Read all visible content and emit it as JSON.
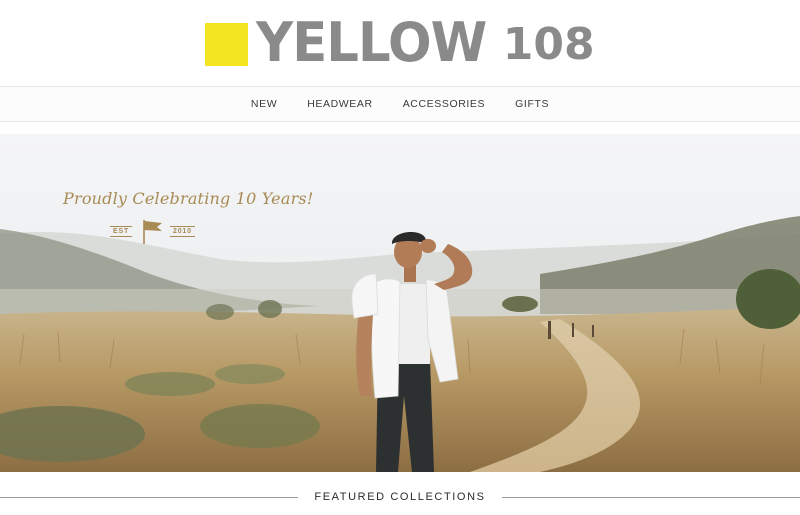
{
  "brand": {
    "wordmark": "YELLOW",
    "number": "108",
    "accent_color": "#f3e621",
    "text_color": "#8a8a8a"
  },
  "nav": {
    "items": [
      {
        "label": "NEW"
      },
      {
        "label": "HEADWEAR"
      },
      {
        "label": "ACCESSORIES"
      },
      {
        "label": "GIFTS"
      }
    ]
  },
  "hero": {
    "tagline": "Proudly Celebrating 10 Years!",
    "badge_left": "EST",
    "badge_right": "2010",
    "badge_icon": "flag-icon",
    "accent_color": "#a88a55"
  },
  "featured": {
    "title": "FEATURED COLLECTIONS"
  }
}
